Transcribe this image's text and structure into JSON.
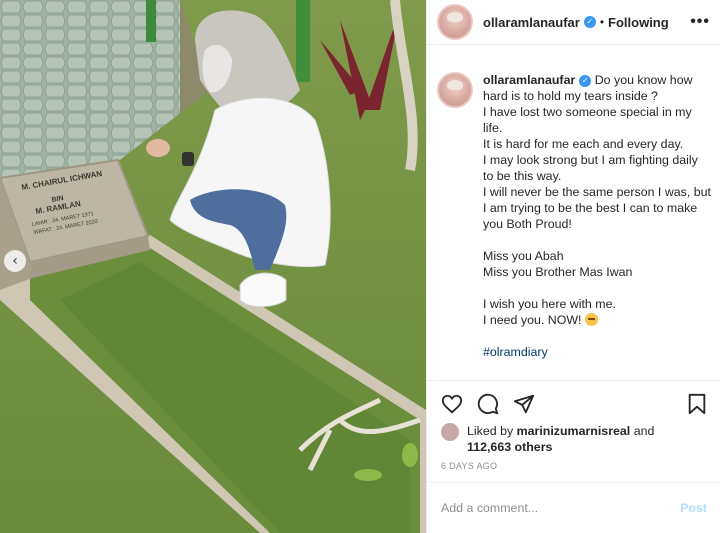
{
  "post": {
    "username": "ollaramlanaufar",
    "following_label": "Following",
    "more_icon": "more-horizontal-icon",
    "verified_icon": "verified-badge-icon"
  },
  "caption": {
    "username": "ollaramlanaufar",
    "lines": [
      "Do you know how hard is to hold my tears inside ?",
      "I have lost two someone special in my life.",
      "It is hard for me each and every day.",
      "I may look strong but I am fighting daily to be this way.",
      "I will never be the same person I was, but I am trying to be the best I can to make you Both Proud!",
      "Miss you Abah",
      "Miss you Brother Mas Iwan",
      "I wish you here with me.",
      "I need you. NOW!"
    ],
    "hashtag": "#olramdiary"
  },
  "photo": {
    "headstone_lines": [
      "M. CHAIRUL ICHWAN",
      "BIN",
      "M. RAMLAN",
      "LAHIR : 24. MARET 1971",
      "WAFAT : 24. MARET 2020"
    ]
  },
  "likes": {
    "liked_by_prefix": "Liked by",
    "liker": "marinizumarnisreal",
    "and": "and",
    "others": "112,663 others"
  },
  "date": "6 DAYS AGO",
  "comment": {
    "placeholder": "Add a comment...",
    "post_label": "Post"
  },
  "colors": {
    "accent": "#3897f0",
    "post_disabled": "#b2dffc",
    "hashtag": "#00376b",
    "secondary_text": "#8e8e8e"
  }
}
